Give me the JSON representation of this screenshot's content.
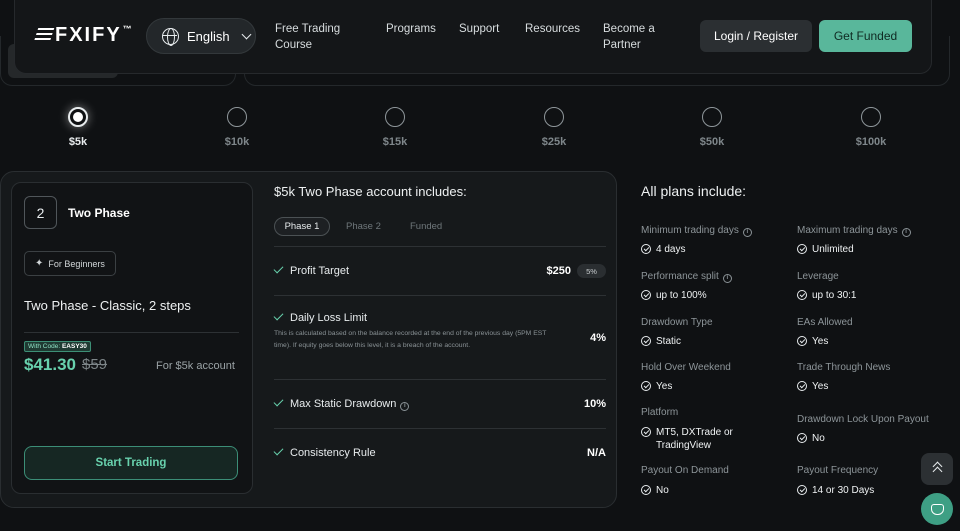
{
  "brand": {
    "logo_text": "FXIFY",
    "trademark": "™"
  },
  "nav": {
    "language": "English",
    "links": [
      "Free Trading Course",
      "Programs",
      "Support",
      "Resources",
      "Become a Partner"
    ],
    "login_label": "Login / Register",
    "cta_label": "Get Funded"
  },
  "sizes": {
    "selected": "$5k",
    "options": [
      "$5k",
      "$10k",
      "$15k",
      "$25k",
      "$50k",
      "$100k"
    ]
  },
  "plan": {
    "number": "2",
    "name": "Two Phase",
    "tag": "For Beginners",
    "description": "Two Phase - Classic, 2 steps",
    "code_prefix": "With Code:",
    "code": "EASY30",
    "price": "$41.30",
    "old_price": "$59",
    "price_note": "For $5k account",
    "start_label": "Start Trading"
  },
  "includes": {
    "title": "$5k Two Phase account includes:",
    "tabs": [
      "Phase 1",
      "Phase 2",
      "Funded"
    ],
    "active_tab": "Phase 1",
    "rules": [
      {
        "name": "Profit Target",
        "value": "$250",
        "pill": "5%"
      },
      {
        "name": "Daily Loss Limit",
        "value": "4%",
        "note": "This is calculated based on the balance recorded at the end of the previous day (5PM EST time). If equity goes below this level, it is a breach of the account."
      },
      {
        "name": "Max Static Drawdown",
        "value": "10%"
      },
      {
        "name": "Consistency Rule",
        "value": "N/A"
      }
    ]
  },
  "all_plans": {
    "title": "All plans include:",
    "specs": [
      {
        "label": "Minimum trading days",
        "value": "4 days"
      },
      {
        "label": "Maximum trading days",
        "value": "Unlimited"
      },
      {
        "label": "Performance split",
        "value": "up to 100%"
      },
      {
        "label": "Leverage",
        "value": "up to 30:1"
      },
      {
        "label": "Drawdown Type",
        "value": "Static"
      },
      {
        "label": "EAs Allowed",
        "value": "Yes"
      },
      {
        "label": "Hold Over Weekend",
        "value": "Yes"
      },
      {
        "label": "Trade Through News",
        "value": "Yes"
      },
      {
        "label": "Platform",
        "value": "MT5, DXTrade or TradingView"
      },
      {
        "label": "Drawdown Lock Upon Payout",
        "value": "No"
      },
      {
        "label": "Payout On Demand",
        "value": "No"
      },
      {
        "label": "Payout Frequency",
        "value": "14 or 30 Days"
      }
    ]
  },
  "colors": {
    "accent": "#68d1ad",
    "cta": "#59b79b",
    "background": "#0f1113"
  }
}
